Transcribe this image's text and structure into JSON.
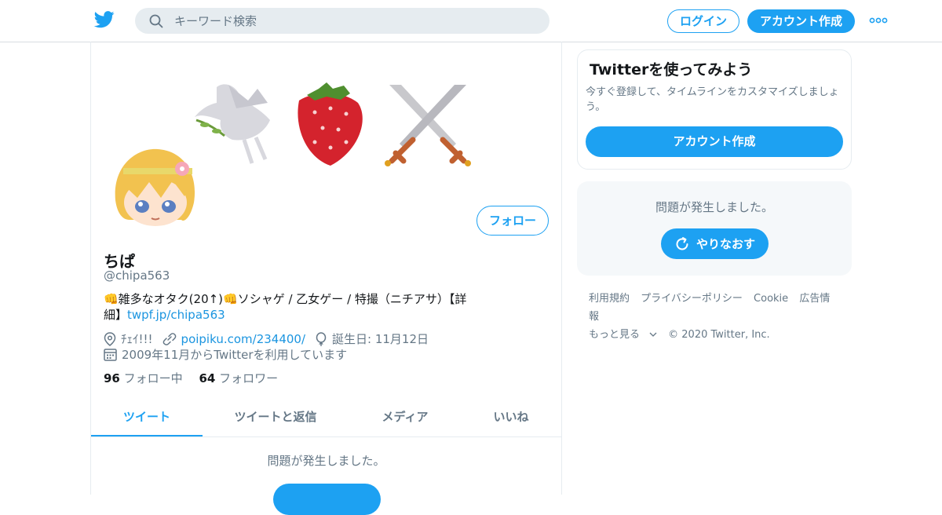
{
  "header": {
    "search_placeholder": "キーワード検索",
    "login_label": "ログイン",
    "signup_label": "アカウント作成",
    "accent": "#1da1f2"
  },
  "profile": {
    "name": "ちぱ",
    "handle": "@chipa563",
    "bio_text": "👊雑多なオタク(20↑)👊ソシャゲ / 乙女ゲー / 特撮（ニチアサ）【詳細】",
    "bio_link": "twpf.jp/chipa563",
    "location": "ﾁｪｲ!!!",
    "website": "poipiku.com/234400/",
    "birthday": "誕生日: 11月12日",
    "joined": "2009年11月からTwitterを利用しています",
    "following_count": "96",
    "following_label": "フォロー中",
    "followers_count": "64",
    "followers_label": "フォロワー",
    "follow_label": "フォロー"
  },
  "tabs": [
    {
      "label": "ツイート",
      "active": true
    },
    {
      "label": "ツイートと返信",
      "active": false
    },
    {
      "label": "メディア",
      "active": false
    },
    {
      "label": "いいね",
      "active": false
    }
  ],
  "timeline": {
    "error": "問題が発生しました。"
  },
  "sidebar": {
    "card_title": "Twitterを使ってみよう",
    "card_text": "今すぐ登録して、タイムラインをカスタマイズしましょう。",
    "card_button": "アカウント作成",
    "error_text": "問題が発生しました。",
    "retry_label": "やりなおす",
    "footer_links": [
      "利用規約",
      "プライバシーポリシー",
      "Cookie",
      "広告情報"
    ],
    "footer_more": "もっと見る",
    "footer_copyright": "© 2020 Twitter, Inc."
  }
}
